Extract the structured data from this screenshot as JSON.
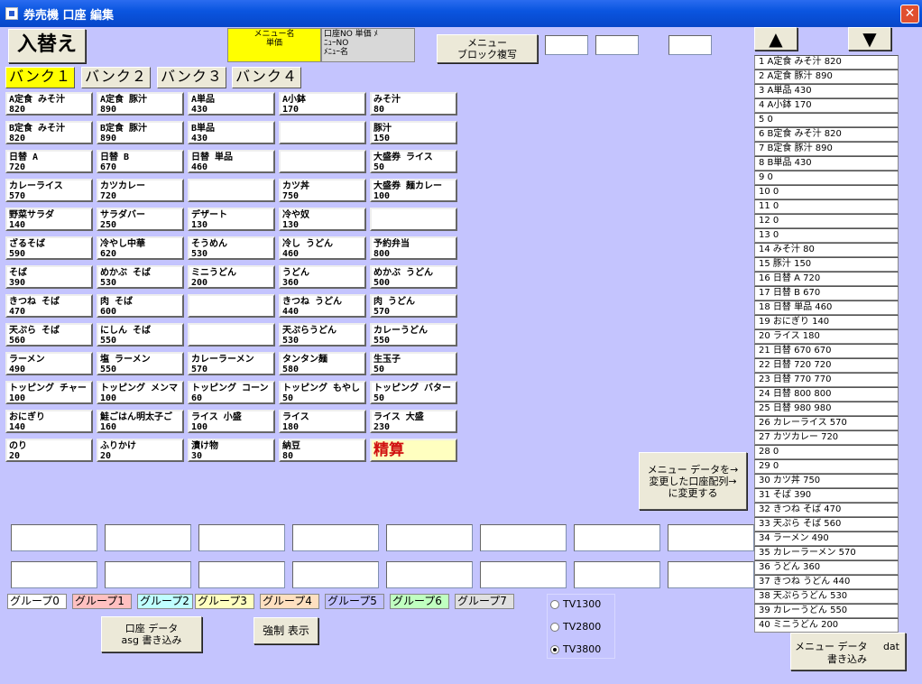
{
  "window": {
    "title": "券売機 口座 編集",
    "close_label": "✕"
  },
  "buttons": {
    "swap": "入替え",
    "block_copy": "メニュー\nブロック複写",
    "apply": "メニュー データを→\n変更した口座配列→\nに変更する",
    "write_asg": "口座 データ\nasg 書き込み",
    "force_show": "強制 表示",
    "write_dat_a": "メニュー データ",
    "write_dat_b": "dat",
    "write_dat_c": "書き込み",
    "up": "▲",
    "down": "▼"
  },
  "legend": {
    "menu": "メニュー名\n単価",
    "acct": "口座NO 単価 ﾒ\nﾆｭｰNO\nﾒﾆｭｰ名"
  },
  "banks": [
    "バンク１",
    "バンク２",
    "バンク３",
    "バンク４"
  ],
  "grid": [
    [
      "A定食 みそ汁\n820",
      "A定食 豚汁\n890",
      "A単品\n430",
      "A小鉢\n170",
      "みそ汁\n80"
    ],
    [
      "B定食 みそ汁\n820",
      "B定食 豚汁\n890",
      "B単品\n430",
      "",
      "豚汁\n150"
    ],
    [
      "日替 A\n720",
      "日替 B\n670",
      "日替 単品\n460",
      "",
      "大盛券 ライス\n50"
    ],
    [
      "カレーライス\n570",
      "カツカレー\n720",
      "",
      "カツ丼\n750",
      "大盛券 麺カレー\n100"
    ],
    [
      "野菜サラダ\n140",
      "サラダバー\n250",
      "デザート\n130",
      "冷や奴\n130",
      ""
    ],
    [
      "ざるそば\n590",
      "冷やし中華\n620",
      "そうめん\n530",
      "冷し うどん\n460",
      "予約弁当\n800"
    ],
    [
      "そば\n390",
      "めかぶ そば\n530",
      "ミニうどん\n200",
      "うどん\n360",
      "めかぶ うどん\n500"
    ],
    [
      "きつね そば\n470",
      "肉 そば\n600",
      "",
      "きつね うどん\n440",
      "肉 うどん\n570"
    ],
    [
      "天ぷら そば\n560",
      "にしん そば\n550",
      "",
      "天ぷらうどん\n530",
      "カレーうどん\n550"
    ],
    [
      "ラーメン\n490",
      "塩 ラーメン\n550",
      "カレーラーメン\n570",
      "タンタン麺\n580",
      "生玉子\n50"
    ],
    [
      "トッピング チャー\n100",
      "トッピング メンマ\n100",
      "トッピング コーン\n60",
      "トッピング もやし\n50",
      "トッピング バター\n50"
    ],
    [
      "おにぎり\n140",
      "鮭ごはん明太子ご\n160",
      "ライス 小盛\n100",
      "ライス\n180",
      "ライス 大盛\n230"
    ],
    [
      "のり\n20",
      "ふりかけ\n20",
      "漬け物\n30",
      "納豆\n80",
      "精算"
    ]
  ],
  "list": [
    "1 A定食 みそ汁 820",
    "2 A定食 豚汁 890",
    "3 A単品 430",
    "4 A小鉢 170",
    "5 0",
    "6 B定食 みそ汁 820",
    "7 B定食 豚汁 890",
    "8 B単品 430",
    "9 0",
    "10 0",
    "11 0",
    "12 0",
    "13 0",
    "14 みそ汁 80",
    "15 豚汁 150",
    "16 日替 A 720",
    "17 日替 B 670",
    "18 日替 単品 460",
    "19 おにぎり 140",
    "20 ライス 180",
    "21 日替 670 670",
    "22 日替 720 720",
    "23 日替 770 770",
    "24 日替 800 800",
    "25 日替 980 980",
    "26 カレーライス 570",
    "27 カツカレー 720",
    "28 0",
    "29 0",
    "30 カツ丼 750",
    "31 そば 390",
    "32 きつね そば 470",
    "33 天ぷら そば 560",
    "34 ラーメン 490",
    "35 カレーラーメン 570",
    "36 うどん 360",
    "37 きつね うどん 440",
    "38 天ぷらうどん 530",
    "39 カレーうどん 550",
    "40 ミニうどん 200"
  ],
  "groups": [
    {
      "label": "グループ0",
      "color": "#ffffff"
    },
    {
      "label": "グループ1",
      "color": "#ffc0c0"
    },
    {
      "label": "グループ2",
      "color": "#c0ffff"
    },
    {
      "label": "グループ3",
      "color": "#ffffc0"
    },
    {
      "label": "グループ4",
      "color": "#ffe0c0"
    },
    {
      "label": "グループ5",
      "color": "#c0c0ff"
    },
    {
      "label": "グループ6",
      "color": "#c0ffc0"
    },
    {
      "label": "グループ7",
      "color": "#e0e0e0"
    }
  ],
  "radios": [
    {
      "label": "TV1300",
      "checked": false
    },
    {
      "label": "TV2800",
      "checked": false
    },
    {
      "label": "TV3800",
      "checked": true
    }
  ],
  "colors": {
    "background": "#c4c4fe",
    "bank_active": "#ffff00",
    "settle_bg": "#ffffc0",
    "settle_text": "#d01010"
  }
}
